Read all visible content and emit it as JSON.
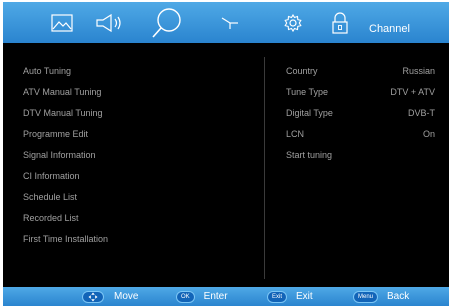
{
  "tabs": [
    {
      "icon": "picture-icon"
    },
    {
      "icon": "sound-icon"
    },
    {
      "icon": "search-icon"
    },
    {
      "icon": "time-icon"
    },
    {
      "icon": "settings-icon"
    },
    {
      "icon": "lock-icon"
    }
  ],
  "active_tab_label": "Channel",
  "menu_items": [
    "Auto Tuning",
    "ATV Manual Tuning",
    "DTV Manual Tuning",
    "Programme Edit",
    "Signal Information",
    "CI Information",
    "Schedule List",
    "Recorded List",
    "First Time Installation"
  ],
  "settings": [
    {
      "name": "Country",
      "value": "Russian"
    },
    {
      "name": "Tune Type",
      "value": "DTV + ATV"
    },
    {
      "name": "Digital Type",
      "value": "DVB-T"
    },
    {
      "name": "LCN",
      "value": "On"
    },
    {
      "name": "Start tuning",
      "value": ""
    }
  ],
  "hints": [
    {
      "key": "",
      "key_icon": "dpad-icon",
      "label": "Move"
    },
    {
      "key": "OK",
      "label": "Enter"
    },
    {
      "key": "Exit",
      "label": "Exit"
    },
    {
      "key": "Menu",
      "label": "Back"
    }
  ],
  "colors": {
    "bar_blue": "#3a96dc",
    "background": "#000000",
    "text_gray": "#a0a0a0",
    "key_blue": "#1264b8"
  }
}
